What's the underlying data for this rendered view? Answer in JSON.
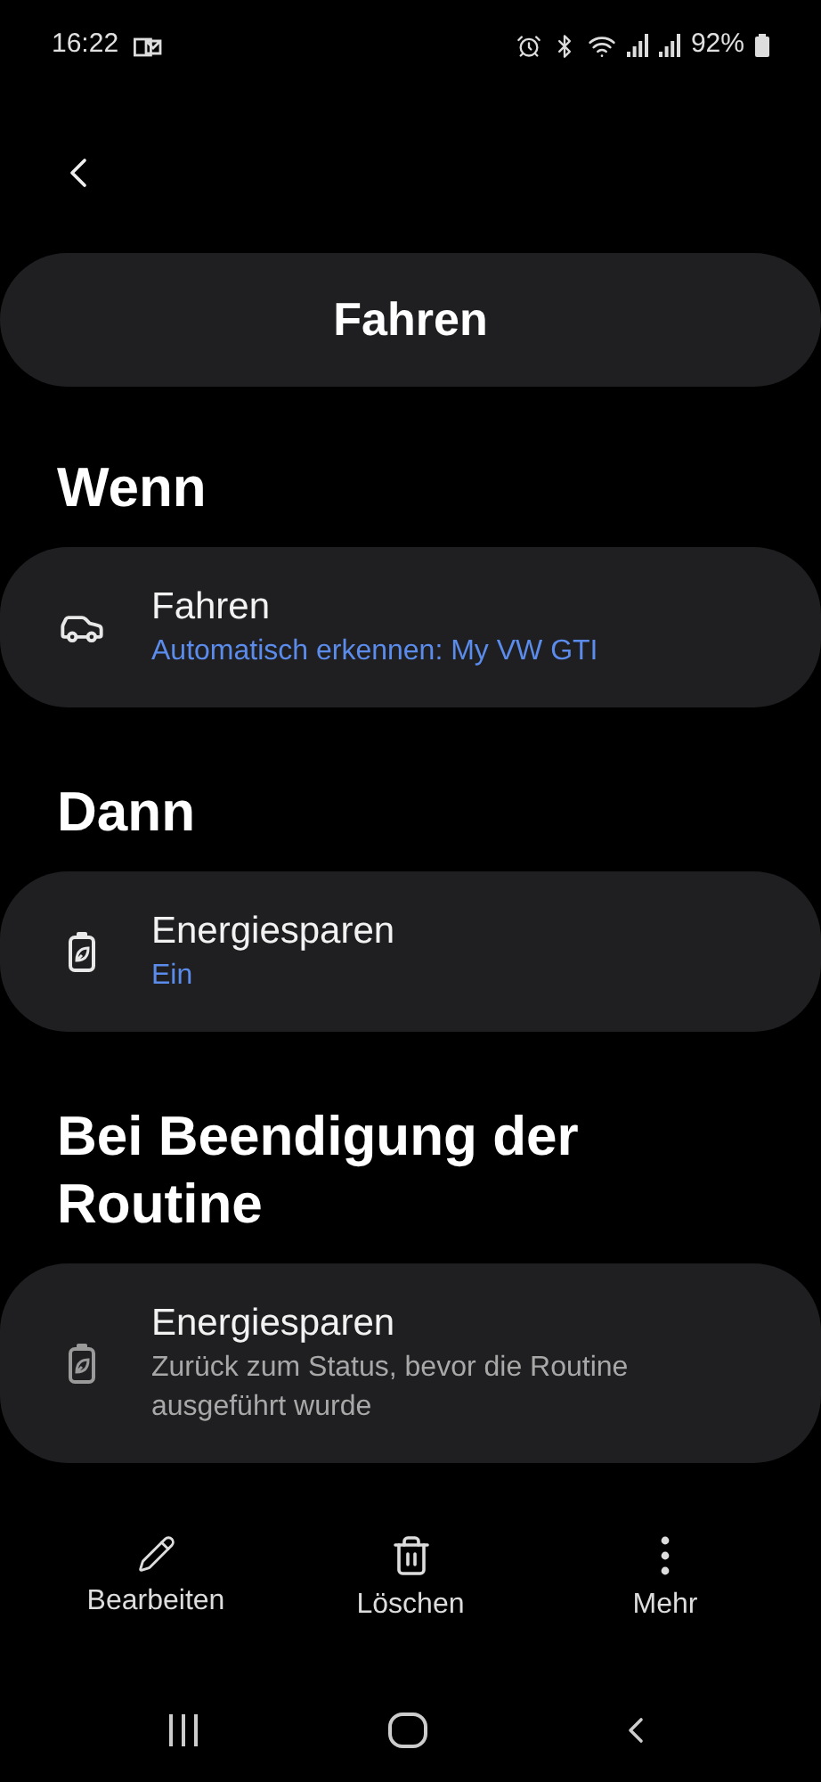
{
  "status_bar": {
    "time": "16:22",
    "battery": "92%"
  },
  "title": "Fahren",
  "sections": [
    {
      "heading": "Wenn",
      "items": [
        {
          "kind": "car",
          "title": "Fahren",
          "subtitle": "Automatisch erkennen: My VW GTI",
          "dimmed": false
        }
      ]
    },
    {
      "heading": "Dann",
      "items": [
        {
          "kind": "battery",
          "title": "Energiesparen",
          "subtitle": "Ein",
          "dimmed": false
        }
      ]
    },
    {
      "heading": "Bei Beendigung der Routine",
      "items": [
        {
          "kind": "battery",
          "title": "Energiesparen",
          "subtitle": "Zurück zum Status, bevor die Routine ausgeführt wurde",
          "dimmed": true
        }
      ]
    }
  ],
  "actions": [
    {
      "kind": "edit",
      "label": "Bearbeiten"
    },
    {
      "kind": "delete",
      "label": "Löschen"
    },
    {
      "kind": "more",
      "label": "Mehr"
    }
  ]
}
